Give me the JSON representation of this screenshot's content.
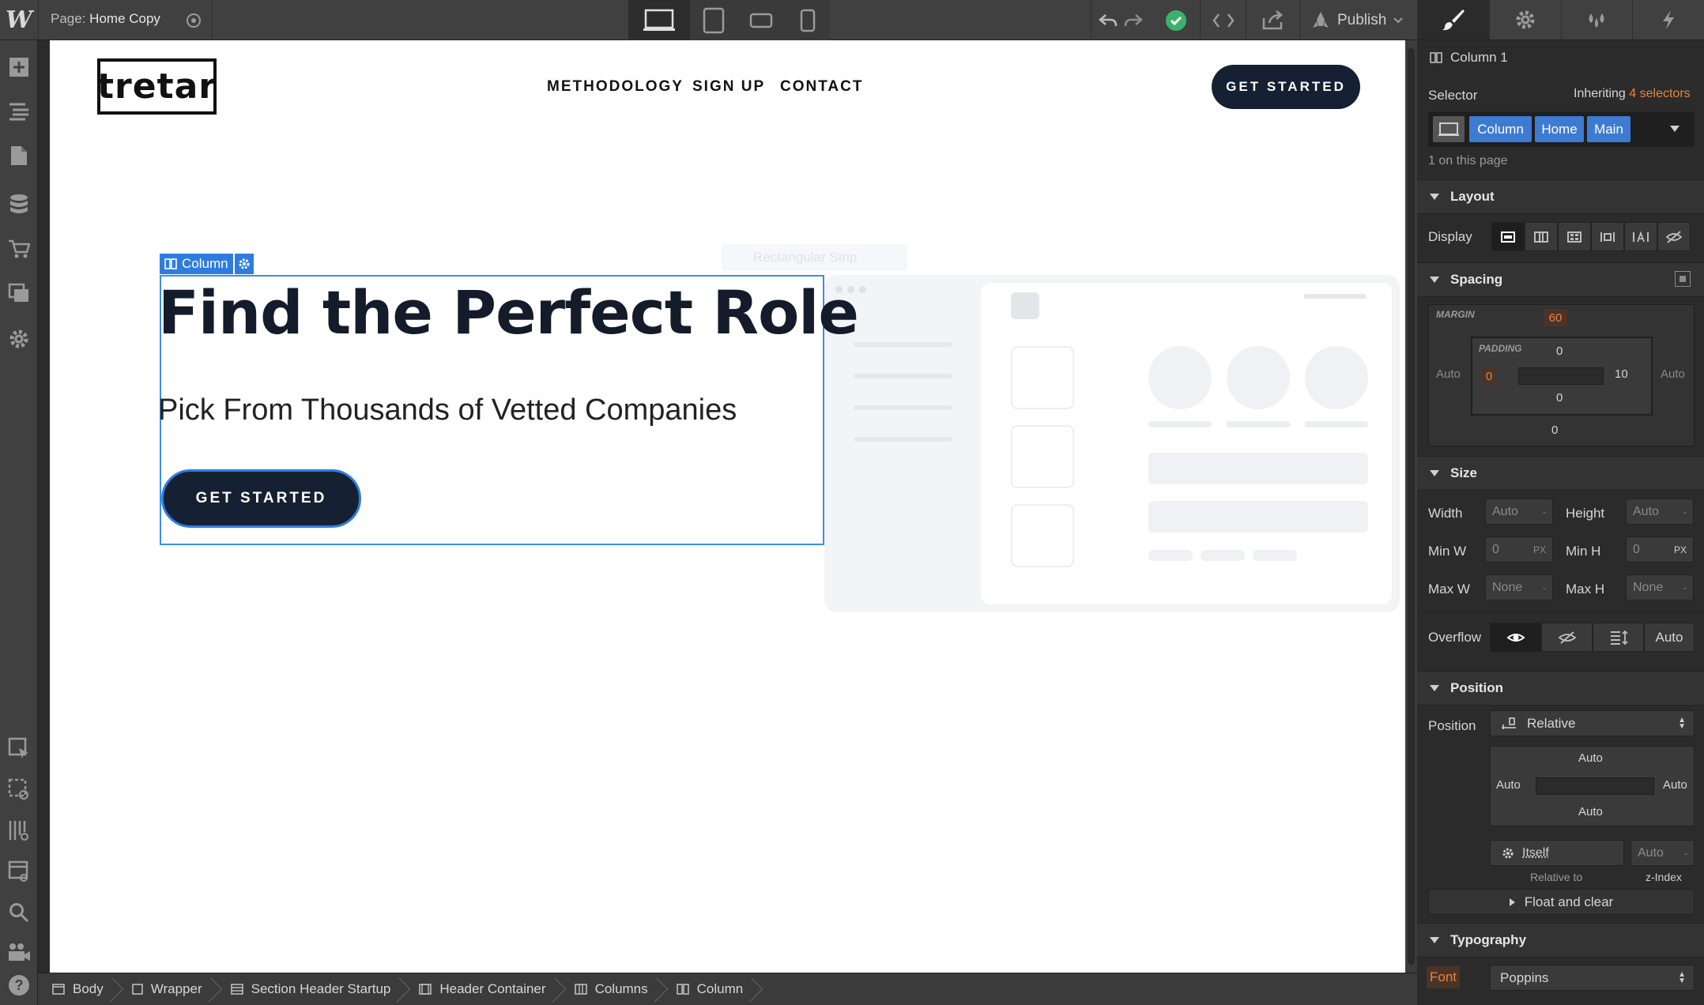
{
  "topbar": {
    "logo": "W",
    "page_prefix": "Page:",
    "page_name": "Home Copy",
    "publish_label": "Publish"
  },
  "site": {
    "logo_text": "tretar",
    "nav": [
      "METHODOLOGY",
      "SIGN UP",
      "CONTACT"
    ],
    "cta_label": "GET STARTED",
    "column_tag": "Column",
    "ghost_tag": "Rectangular Strip",
    "hero_title": "Find the Perfect Role",
    "hero_subtitle": "Pick From Thousands of Vetted Companies",
    "hero_button": "GET STARTED"
  },
  "breadcrumbs": [
    "Body",
    "Wrapper",
    "Section Header Startup",
    "Header Container",
    "Columns",
    "Column"
  ],
  "panel": {
    "element_name": "Column 1",
    "selector_label": "Selector",
    "inheriting_prefix": "Inheriting",
    "inheriting_count": "4 selectors",
    "selector_pills": [
      "Column",
      "Home",
      "Main"
    ],
    "on_page": "1 on this page",
    "layout": {
      "title": "Layout",
      "display_label": "Display"
    },
    "spacing": {
      "title": "Spacing",
      "margin_label": "MARGIN",
      "margin_top": "60",
      "margin_left": "Auto",
      "margin_right": "Auto",
      "margin_bottom": "0",
      "padding_label": "PADDING",
      "padding_top": "0",
      "padding_left": "0",
      "padding_right": "10",
      "padding_bottom": "0"
    },
    "size": {
      "title": "Size",
      "width_label": "Width",
      "width_value": "Auto",
      "width_unit": "-",
      "height_label": "Height",
      "height_value": "Auto",
      "height_unit": "-",
      "minw_label": "Min W",
      "minw_value": "0",
      "minw_unit": "PX",
      "minh_label": "Min H",
      "minh_value": "0",
      "minh_unit": "PX",
      "maxw_label": "Max W",
      "maxw_value": "None",
      "maxw_unit": "-",
      "maxh_label": "Max H",
      "maxh_value": "None",
      "maxh_unit": "-",
      "overflow_label": "Overflow",
      "overflow_auto": "Auto"
    },
    "position": {
      "title": "Position",
      "position_label": "Position",
      "position_value": "Relative",
      "top": "Auto",
      "left": "Auto",
      "right": "Auto",
      "bottom": "Auto",
      "relative_value": "Itself",
      "relative_label": "Relative to",
      "zindex_value": "Auto",
      "zindex_unit": "-",
      "zindex_label": "z-Index",
      "float_label": "Float and clear"
    },
    "typography": {
      "title": "Typography",
      "font_label": "Font",
      "font_value": "Poppins"
    }
  },
  "colors": {
    "accent": "#3d7bd3",
    "orange": "#e9833e",
    "dark_button": "#162033",
    "success": "#3bb26b"
  }
}
